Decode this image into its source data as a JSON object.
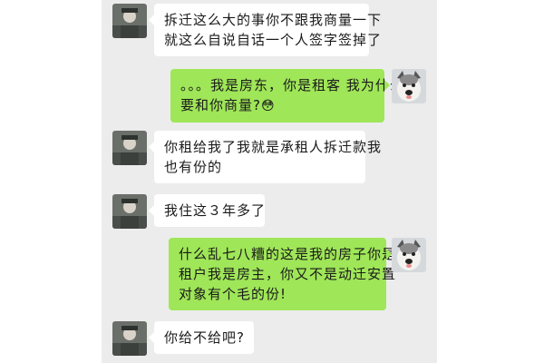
{
  "messages": [
    {
      "side": "in",
      "lines": [
        "拆迁这么大的事你不跟我商量一下",
        "就这么自说自话一个人签字签掉了"
      ]
    },
    {
      "side": "out",
      "lines": [
        "。。。我是房东，你是租客 我为什么",
        "要和你商量?"
      ],
      "emoji": "😳"
    },
    {
      "side": "in",
      "lines": [
        "你租给我了我就是承租人拆迁款我",
        "也有份的"
      ]
    },
    {
      "side": "in",
      "lines": [
        "我住这３年多了"
      ]
    },
    {
      "side": "out",
      "lines": [
        "什么乱七八糟的这是我的房子你是",
        "租户我是房主，你又不是动迁安置",
        "对象有个毛的份!"
      ]
    },
    {
      "side": "in",
      "lines": [
        "你给不给吧?"
      ]
    }
  ],
  "avatars": {
    "in": {
      "icon": "person-avatar-icon",
      "color": "#5a5f5a"
    },
    "out": {
      "icon": "dog-avatar-icon",
      "color": "#cfd3d6"
    }
  },
  "colors": {
    "background": "#ececec",
    "incoming": "#ffffff",
    "outgoing": "#9fe658"
  }
}
